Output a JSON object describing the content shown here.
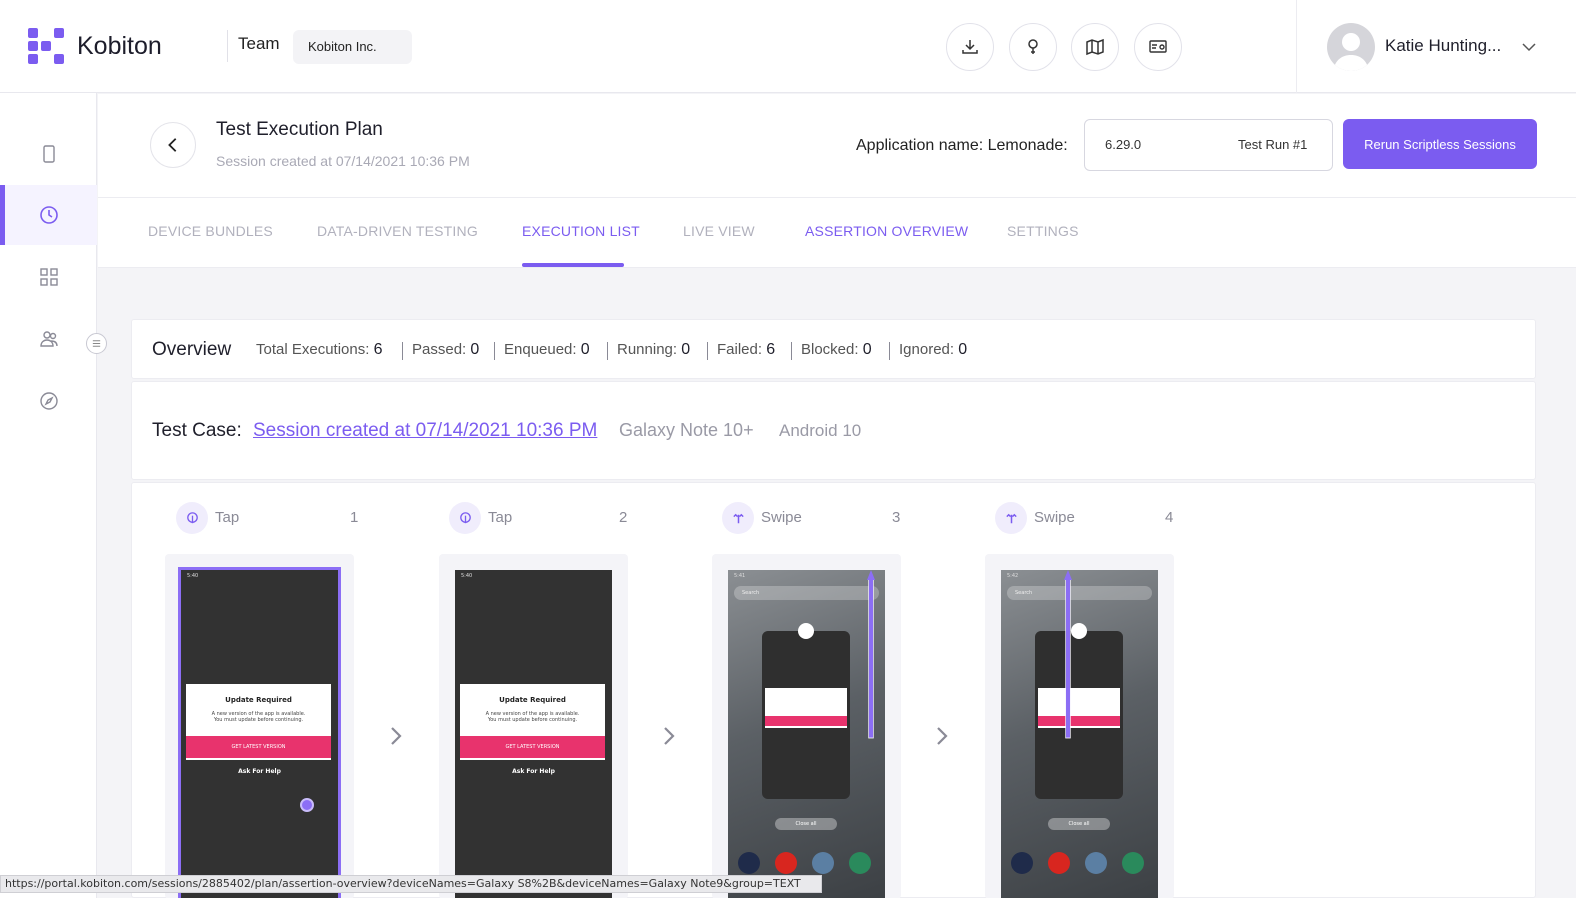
{
  "brand": {
    "name": "Kobiton",
    "color": "#7b5cf0"
  },
  "header": {
    "team_label": "Team",
    "team_value": "Kobiton Inc.",
    "icons": [
      "download-icon",
      "help-icon",
      "map-icon",
      "api-settings-icon"
    ],
    "user_name": "Katie Hunting..."
  },
  "sidebar": {
    "items": [
      "device-icon",
      "clock-icon",
      "grid-icon",
      "users-icon",
      "compass-icon"
    ],
    "active_index": 1
  },
  "page": {
    "title": "Test Execution Plan",
    "subtitle": "Session created at 07/14/2021 10:36 PM",
    "app_name_label": "Application name: Lemonade:",
    "version": "6.29.0",
    "run": "Test Run #1",
    "rerun_button": "Rerun Scriptless Sessions"
  },
  "tabs": [
    {
      "label": "DEVICE BUNDLES",
      "state": "inactive"
    },
    {
      "label": "DATA-DRIVEN TESTING",
      "state": "inactive"
    },
    {
      "label": "EXECUTION LIST",
      "state": "active"
    },
    {
      "label": "LIVE VIEW",
      "state": "inactive"
    },
    {
      "label": "ASSERTION OVERVIEW",
      "state": "accent"
    },
    {
      "label": "SETTINGS",
      "state": "inactive"
    }
  ],
  "overview": {
    "title": "Overview",
    "stats": [
      {
        "label": "Total Executions:",
        "value": "6"
      },
      {
        "label": "Passed:",
        "value": "0"
      },
      {
        "label": "Enqueued:",
        "value": "0"
      },
      {
        "label": "Running:",
        "value": "0"
      },
      {
        "label": "Failed:",
        "value": "6"
      },
      {
        "label": "Blocked:",
        "value": "0"
      },
      {
        "label": "Ignored:",
        "value": "0"
      }
    ]
  },
  "test_case": {
    "label": "Test Case:",
    "link": "Session created at 07/14/2021 10:36 PM",
    "device": "Galaxy Note 10+",
    "os": "Android 10"
  },
  "steps": [
    {
      "action": "Tap",
      "number": "1",
      "icon": "tap-icon",
      "time": "5:40",
      "selected": true
    },
    {
      "action": "Tap",
      "number": "2",
      "icon": "tap-icon",
      "time": "5:40",
      "selected": false
    },
    {
      "action": "Swipe",
      "number": "3",
      "icon": "swipe-icon",
      "time": "5:41",
      "selected": false
    },
    {
      "action": "Swipe",
      "number": "4",
      "icon": "swipe-icon",
      "time": "5:42",
      "selected": false
    }
  ],
  "screen": {
    "dialog_title": "Update Required",
    "dialog_body_1": "A new version of the app is available.",
    "dialog_body_2": "You must update before continuing.",
    "dialog_button": "GET LATEST VERSION",
    "ask_help": "Ask For Help",
    "search": "Search",
    "close_all": "Close all"
  },
  "status_url": "https://portal.kobiton.com/sessions/2885402/plan/assertion-overview?deviceNames=Galaxy S8%2B&deviceNames=Galaxy Note9&group=TEXT"
}
